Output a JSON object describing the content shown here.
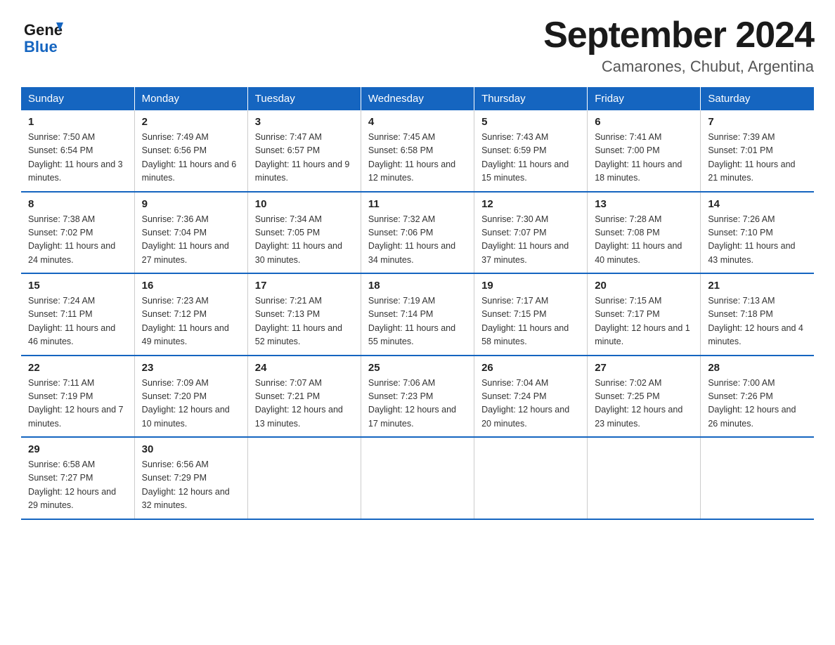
{
  "header": {
    "logo_general": "General",
    "logo_blue": "Blue",
    "month_title": "September 2024",
    "location": "Camarones, Chubut, Argentina"
  },
  "days_of_week": [
    "Sunday",
    "Monday",
    "Tuesday",
    "Wednesday",
    "Thursday",
    "Friday",
    "Saturday"
  ],
  "weeks": [
    [
      {
        "day": "1",
        "sunrise": "Sunrise: 7:50 AM",
        "sunset": "Sunset: 6:54 PM",
        "daylight": "Daylight: 11 hours and 3 minutes."
      },
      {
        "day": "2",
        "sunrise": "Sunrise: 7:49 AM",
        "sunset": "Sunset: 6:56 PM",
        "daylight": "Daylight: 11 hours and 6 minutes."
      },
      {
        "day": "3",
        "sunrise": "Sunrise: 7:47 AM",
        "sunset": "Sunset: 6:57 PM",
        "daylight": "Daylight: 11 hours and 9 minutes."
      },
      {
        "day": "4",
        "sunrise": "Sunrise: 7:45 AM",
        "sunset": "Sunset: 6:58 PM",
        "daylight": "Daylight: 11 hours and 12 minutes."
      },
      {
        "day": "5",
        "sunrise": "Sunrise: 7:43 AM",
        "sunset": "Sunset: 6:59 PM",
        "daylight": "Daylight: 11 hours and 15 minutes."
      },
      {
        "day": "6",
        "sunrise": "Sunrise: 7:41 AM",
        "sunset": "Sunset: 7:00 PM",
        "daylight": "Daylight: 11 hours and 18 minutes."
      },
      {
        "day": "7",
        "sunrise": "Sunrise: 7:39 AM",
        "sunset": "Sunset: 7:01 PM",
        "daylight": "Daylight: 11 hours and 21 minutes."
      }
    ],
    [
      {
        "day": "8",
        "sunrise": "Sunrise: 7:38 AM",
        "sunset": "Sunset: 7:02 PM",
        "daylight": "Daylight: 11 hours and 24 minutes."
      },
      {
        "day": "9",
        "sunrise": "Sunrise: 7:36 AM",
        "sunset": "Sunset: 7:04 PM",
        "daylight": "Daylight: 11 hours and 27 minutes."
      },
      {
        "day": "10",
        "sunrise": "Sunrise: 7:34 AM",
        "sunset": "Sunset: 7:05 PM",
        "daylight": "Daylight: 11 hours and 30 minutes."
      },
      {
        "day": "11",
        "sunrise": "Sunrise: 7:32 AM",
        "sunset": "Sunset: 7:06 PM",
        "daylight": "Daylight: 11 hours and 34 minutes."
      },
      {
        "day": "12",
        "sunrise": "Sunrise: 7:30 AM",
        "sunset": "Sunset: 7:07 PM",
        "daylight": "Daylight: 11 hours and 37 minutes."
      },
      {
        "day": "13",
        "sunrise": "Sunrise: 7:28 AM",
        "sunset": "Sunset: 7:08 PM",
        "daylight": "Daylight: 11 hours and 40 minutes."
      },
      {
        "day": "14",
        "sunrise": "Sunrise: 7:26 AM",
        "sunset": "Sunset: 7:10 PM",
        "daylight": "Daylight: 11 hours and 43 minutes."
      }
    ],
    [
      {
        "day": "15",
        "sunrise": "Sunrise: 7:24 AM",
        "sunset": "Sunset: 7:11 PM",
        "daylight": "Daylight: 11 hours and 46 minutes."
      },
      {
        "day": "16",
        "sunrise": "Sunrise: 7:23 AM",
        "sunset": "Sunset: 7:12 PM",
        "daylight": "Daylight: 11 hours and 49 minutes."
      },
      {
        "day": "17",
        "sunrise": "Sunrise: 7:21 AM",
        "sunset": "Sunset: 7:13 PM",
        "daylight": "Daylight: 11 hours and 52 minutes."
      },
      {
        "day": "18",
        "sunrise": "Sunrise: 7:19 AM",
        "sunset": "Sunset: 7:14 PM",
        "daylight": "Daylight: 11 hours and 55 minutes."
      },
      {
        "day": "19",
        "sunrise": "Sunrise: 7:17 AM",
        "sunset": "Sunset: 7:15 PM",
        "daylight": "Daylight: 11 hours and 58 minutes."
      },
      {
        "day": "20",
        "sunrise": "Sunrise: 7:15 AM",
        "sunset": "Sunset: 7:17 PM",
        "daylight": "Daylight: 12 hours and 1 minute."
      },
      {
        "day": "21",
        "sunrise": "Sunrise: 7:13 AM",
        "sunset": "Sunset: 7:18 PM",
        "daylight": "Daylight: 12 hours and 4 minutes."
      }
    ],
    [
      {
        "day": "22",
        "sunrise": "Sunrise: 7:11 AM",
        "sunset": "Sunset: 7:19 PM",
        "daylight": "Daylight: 12 hours and 7 minutes."
      },
      {
        "day": "23",
        "sunrise": "Sunrise: 7:09 AM",
        "sunset": "Sunset: 7:20 PM",
        "daylight": "Daylight: 12 hours and 10 minutes."
      },
      {
        "day": "24",
        "sunrise": "Sunrise: 7:07 AM",
        "sunset": "Sunset: 7:21 PM",
        "daylight": "Daylight: 12 hours and 13 minutes."
      },
      {
        "day": "25",
        "sunrise": "Sunrise: 7:06 AM",
        "sunset": "Sunset: 7:23 PM",
        "daylight": "Daylight: 12 hours and 17 minutes."
      },
      {
        "day": "26",
        "sunrise": "Sunrise: 7:04 AM",
        "sunset": "Sunset: 7:24 PM",
        "daylight": "Daylight: 12 hours and 20 minutes."
      },
      {
        "day": "27",
        "sunrise": "Sunrise: 7:02 AM",
        "sunset": "Sunset: 7:25 PM",
        "daylight": "Daylight: 12 hours and 23 minutes."
      },
      {
        "day": "28",
        "sunrise": "Sunrise: 7:00 AM",
        "sunset": "Sunset: 7:26 PM",
        "daylight": "Daylight: 12 hours and 26 minutes."
      }
    ],
    [
      {
        "day": "29",
        "sunrise": "Sunrise: 6:58 AM",
        "sunset": "Sunset: 7:27 PM",
        "daylight": "Daylight: 12 hours and 29 minutes."
      },
      {
        "day": "30",
        "sunrise": "Sunrise: 6:56 AM",
        "sunset": "Sunset: 7:29 PM",
        "daylight": "Daylight: 12 hours and 32 minutes."
      },
      null,
      null,
      null,
      null,
      null
    ]
  ]
}
